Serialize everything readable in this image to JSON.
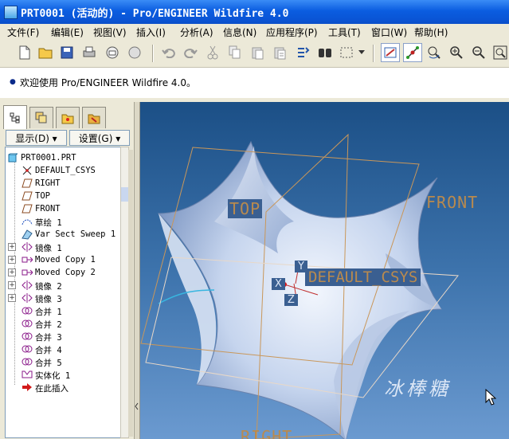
{
  "window": {
    "title": "PRT0001 (活动的) - Pro/ENGINEER Wildfire 4.0"
  },
  "menu": [
    "文件(F)",
    "编辑(E)",
    "视图(V)",
    "插入(I)",
    "分析(A)",
    "信息(N)",
    "应用程序(P)",
    "工具(T)",
    "窗口(W)",
    "帮助(H)"
  ],
  "toolbar": {
    "icons": [
      "new-file-icon",
      "open-folder-icon",
      "save-icon",
      "print-icon",
      "send-mail-icon",
      "send-icon",
      "undo-icon",
      "redo-icon",
      "cut-icon",
      "copy-icon",
      "paste-icon",
      "paste-special-icon",
      "regenerate-icon",
      "find-icon",
      "select-box-icon",
      "dropdown-icon",
      "datum-display-icon",
      "spin-center-icon",
      "orient-icon",
      "zoom-in-icon",
      "zoom-out-icon",
      "refit-icon"
    ]
  },
  "message": {
    "text": "欢迎使用 Pro/ENGINEER Wildfire 4.0。"
  },
  "panel": {
    "show_label": "显示(D) ▾",
    "settings_label": "设置(G) ▾"
  },
  "tree": [
    {
      "label": "PRT0001.PRT",
      "icon": "part-icon"
    },
    {
      "label": "DEFAULT_CSYS",
      "icon": "csys-icon"
    },
    {
      "label": "RIGHT",
      "icon": "datum-plane-icon"
    },
    {
      "label": "TOP",
      "icon": "datum-plane-icon"
    },
    {
      "label": "FRONT",
      "icon": "datum-plane-icon"
    },
    {
      "label": "草绘 1",
      "icon": "sketch-icon"
    },
    {
      "label": "Var Sect Sweep 1",
      "icon": "var-sect-sweep-icon"
    },
    {
      "label": "镜像 1",
      "icon": "mirror-icon"
    },
    {
      "label": "Moved Copy 1",
      "icon": "moved-copy-icon"
    },
    {
      "label": "Moved Copy 2",
      "icon": "moved-copy-icon"
    },
    {
      "label": "镜像 2",
      "icon": "mirror-icon"
    },
    {
      "label": "镜像 3",
      "icon": "mirror-icon"
    },
    {
      "label": "合并 1",
      "icon": "merge-icon"
    },
    {
      "label": "合并 2",
      "icon": "merge-icon"
    },
    {
      "label": "合并 3",
      "icon": "merge-icon"
    },
    {
      "label": "合并 4",
      "icon": "merge-icon"
    },
    {
      "label": "合并 5",
      "icon": "merge-icon"
    },
    {
      "label": "实体化 1",
      "icon": "solidify-icon"
    },
    {
      "label": "在此插入",
      "icon": "insert-here-arrow-icon"
    }
  ],
  "viewport": {
    "labels": {
      "top": "TOP",
      "front": "FRONT",
      "csys": "DEFAULT_CSYS",
      "right": "RIGHT",
      "x": "X",
      "y": "Y",
      "z": "Z"
    },
    "watermark": "冰棒糖"
  }
}
